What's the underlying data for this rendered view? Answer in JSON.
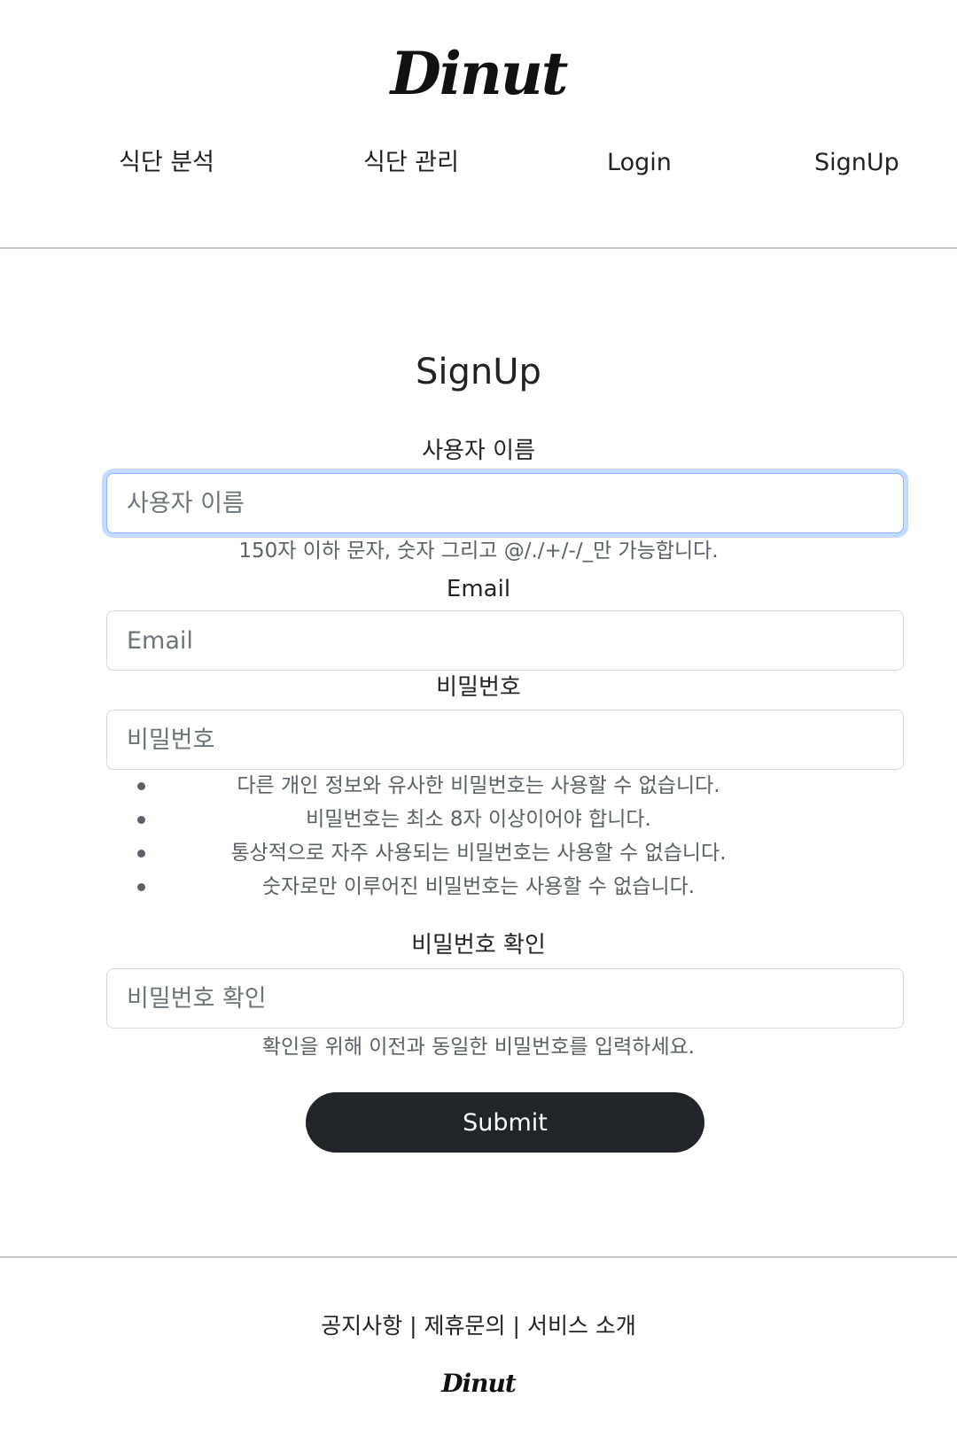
{
  "header": {
    "logo": "Dinut",
    "nav": [
      {
        "label": "식단 분석"
      },
      {
        "label": "식단 관리"
      },
      {
        "label": "Login"
      },
      {
        "label": "SignUp"
      }
    ]
  },
  "form": {
    "title": "SignUp",
    "username": {
      "label": "사용자 이름",
      "placeholder": "사용자 이름",
      "value": "",
      "help": "150자 이하 문자, 숫자 그리고 @/./+/-/_만 가능합니다."
    },
    "email": {
      "label": "Email",
      "placeholder": "Email",
      "value": ""
    },
    "password": {
      "label": "비밀번호",
      "placeholder": "비밀번호",
      "value": "",
      "rules": [
        "다른 개인 정보와 유사한 비밀번호는 사용할 수 없습니다.",
        "비밀번호는 최소 8자 이상이어야 합니다.",
        "통상적으로 자주 사용되는 비밀번호는 사용할 수 없습니다.",
        "숫자로만 이루어진 비밀번호는 사용할 수 없습니다."
      ]
    },
    "password_confirm": {
      "label": "비밀번호 확인",
      "placeholder": "비밀번호 확인",
      "value": "",
      "help": "확인을 위해 이전과 동일한 비밀번호를 입력하세요."
    },
    "submit_label": "Submit"
  },
  "footer": {
    "links": [
      "공지사항",
      "제휴문의",
      "서비스 소개"
    ],
    "separator": "|",
    "logo": "Dinut"
  },
  "colors": {
    "button_bg": "#212529",
    "focus_ring": "#86b7fe",
    "divider": "#c8c8c8"
  }
}
